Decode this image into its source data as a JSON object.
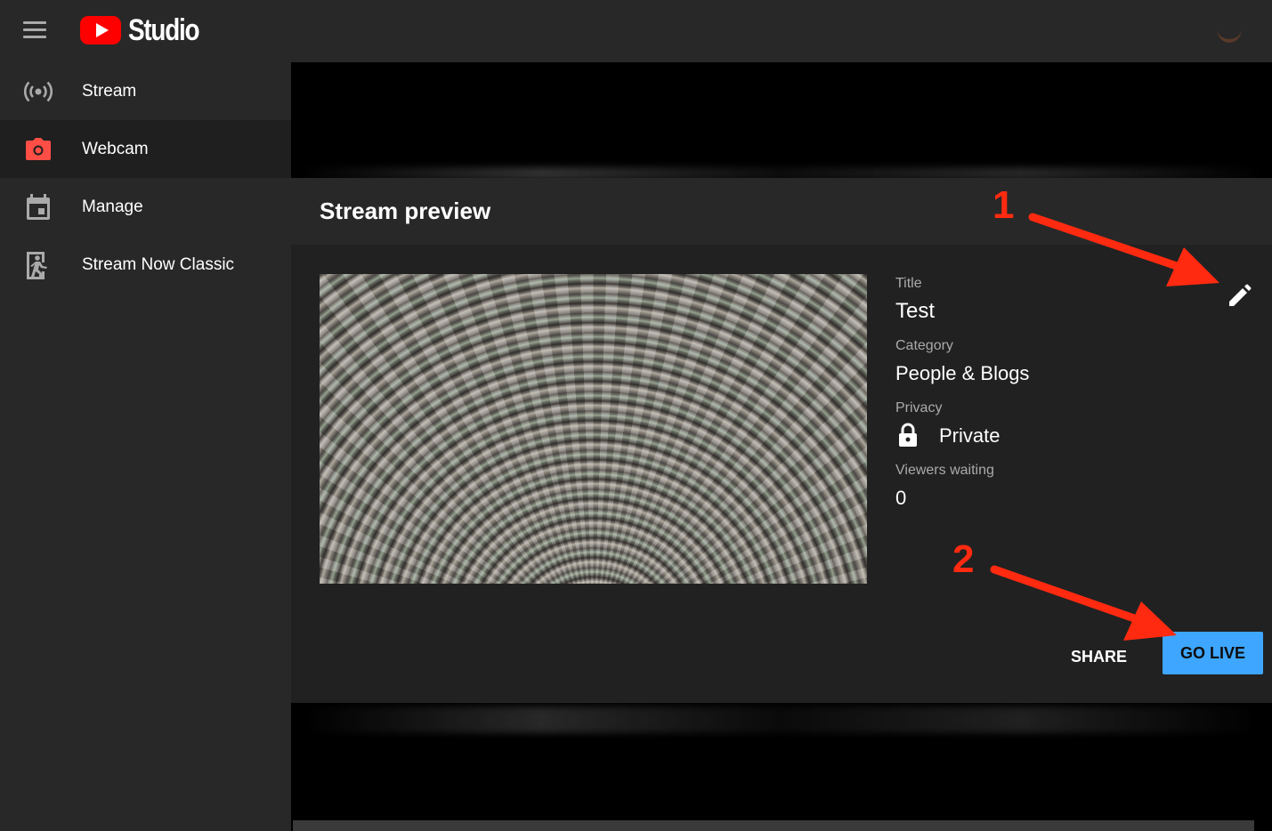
{
  "app": {
    "logo_text": "Studio"
  },
  "sidebar": {
    "items": [
      {
        "label": "Stream",
        "icon": "broadcast-icon",
        "active": false
      },
      {
        "label": "Webcam",
        "icon": "camera-icon",
        "active": true
      },
      {
        "label": "Manage",
        "icon": "calendar-icon",
        "active": false
      },
      {
        "label": "Stream Now Classic",
        "icon": "exit-running-icon",
        "active": false
      }
    ]
  },
  "card": {
    "title": "Stream preview",
    "fields": {
      "title_label": "Title",
      "title_value": "Test",
      "category_label": "Category",
      "category_value": "People & Blogs",
      "privacy_label": "Privacy",
      "privacy_value": "Private",
      "viewers_label": "Viewers waiting",
      "viewers_value": "0"
    },
    "actions": {
      "share": "SHARE",
      "go_live": "GO LIVE"
    }
  },
  "annotations": {
    "step1": "1",
    "step2": "2"
  },
  "colors": {
    "accent": "#3ea6ff",
    "brand": "#ff0000",
    "annotation": "#ff2a10",
    "webcam_icon": "#ff4e45"
  }
}
